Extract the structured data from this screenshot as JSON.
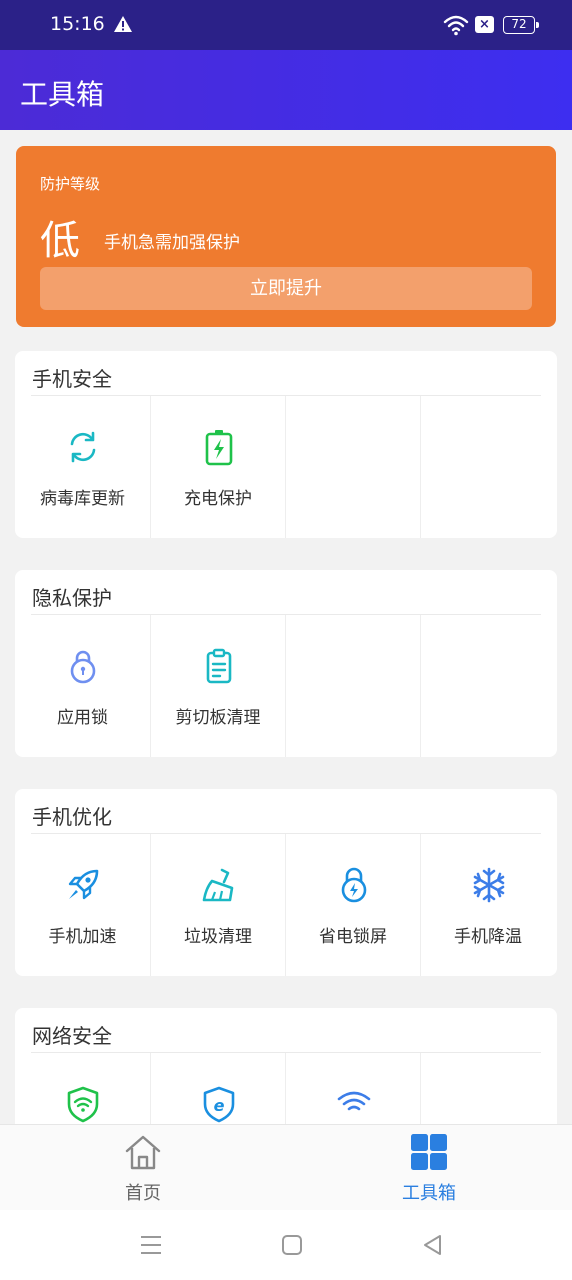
{
  "status_bar": {
    "time": "15:16",
    "battery": "72"
  },
  "app_bar": {
    "title": "工具箱"
  },
  "protection": {
    "label": "防护等级",
    "level": "低",
    "description": "手机急需加强保护",
    "button": "立即提升",
    "color": "#ef7b2f"
  },
  "sections": [
    {
      "title": "手机安全",
      "tools": [
        {
          "label": "病毒库更新",
          "icon": "refresh-icon"
        },
        {
          "label": "充电保护",
          "icon": "battery-charge-icon"
        }
      ]
    },
    {
      "title": "隐私保护",
      "tools": [
        {
          "label": "应用锁",
          "icon": "lock-icon"
        },
        {
          "label": "剪切板清理",
          "icon": "clipboard-icon"
        }
      ]
    },
    {
      "title": "手机优化",
      "tools": [
        {
          "label": "手机加速",
          "icon": "rocket-icon"
        },
        {
          "label": "垃圾清理",
          "icon": "broom-icon"
        },
        {
          "label": "省电锁屏",
          "icon": "lock-bolt-icon"
        },
        {
          "label": "手机降温",
          "icon": "snowflake-icon"
        }
      ]
    },
    {
      "title": "网络安全",
      "tools": [
        {
          "icon": "wifi-shield-icon"
        },
        {
          "icon": "browser-shield-icon"
        },
        {
          "icon": "wifi-icon"
        }
      ]
    }
  ],
  "bottom_nav": {
    "home": "首页",
    "toolbox": "工具箱",
    "active_color": "#2a7fe0"
  }
}
